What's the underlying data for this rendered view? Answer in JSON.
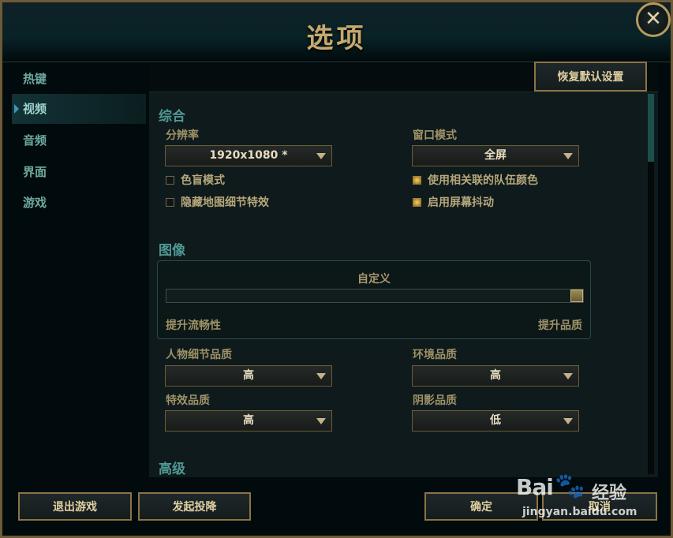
{
  "window": {
    "title": "选项",
    "close_glyph": "✕"
  },
  "sidebar": {
    "items": [
      {
        "label": "热键",
        "active": false
      },
      {
        "label": "视频",
        "active": true
      },
      {
        "label": "音频",
        "active": false
      },
      {
        "label": "界面",
        "active": false
      },
      {
        "label": "游戏",
        "active": false
      }
    ]
  },
  "panel": {
    "reset_label": "恢复默认设置"
  },
  "general": {
    "title": "综合",
    "resolution": {
      "label": "分辨率",
      "value": "1920x1080 *"
    },
    "window_mode": {
      "label": "窗口模式",
      "value": "全屏"
    },
    "colorblind": {
      "label": "色盲模式",
      "checked": false
    },
    "hide_map_effects": {
      "label": "隐藏地图细节特效",
      "checked": false
    },
    "team_colors": {
      "label": "使用相关联的队伍颜色",
      "checked": true
    },
    "screen_shake": {
      "label": "启用屏幕抖动",
      "checked": true
    }
  },
  "graphics": {
    "title": "图像",
    "preset": "自定义",
    "slider_value": 1.0,
    "left_label": "提升流畅性",
    "right_label": "提升品质",
    "character_quality": {
      "label": "人物细节品质",
      "value": "高"
    },
    "environment_quality": {
      "label": "环境品质",
      "value": "高"
    },
    "effects_quality": {
      "label": "特效品质",
      "value": "高"
    },
    "shadow_quality": {
      "label": "阴影品质",
      "value": "低"
    }
  },
  "advanced": {
    "title": "高级"
  },
  "footer": {
    "quit_label": "退出游戏",
    "surrender_label": "发起投降",
    "ok_label": "确定",
    "cancel_label": "取消"
  },
  "watermark": {
    "logo": "Bai",
    "paw": "🐾",
    "jingyan": "经验",
    "url": "jingyan.baidu.com"
  },
  "colors": {
    "gold": "#c5a96d",
    "teal": "#4f9793",
    "checked": "#d8af48"
  }
}
